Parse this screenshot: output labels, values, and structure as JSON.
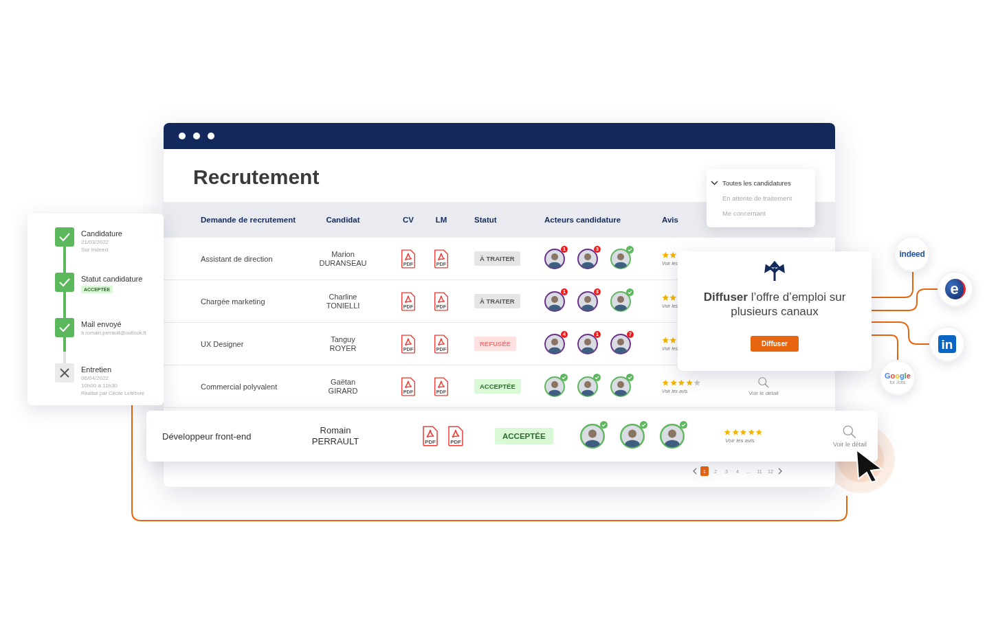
{
  "window": {
    "title": "Recrutement"
  },
  "filter_menu": {
    "items": [
      {
        "label": "Toutes les candidatures",
        "selected": true
      },
      {
        "label": "En attente de traitement",
        "selected": false
      },
      {
        "label": "Me concernant",
        "selected": false
      }
    ]
  },
  "table": {
    "columns": [
      "Demande de recrutement",
      "Candidat",
      "CV",
      "LM",
      "Statut",
      "Acteurs candidature",
      "Avis"
    ],
    "rows": [
      {
        "position": "Assistant de direction",
        "first_name": "Marion",
        "last_name": "DURANSEAU",
        "cv": "PDF",
        "lm": "PDF",
        "status": {
          "kind": "todo",
          "label": "À TRAITER"
        },
        "actors": [
          {
            "kind": "count",
            "badge": "1"
          },
          {
            "kind": "count",
            "badge": "3"
          },
          {
            "kind": "done"
          }
        ],
        "reviews": "Voir les"
      },
      {
        "position": "Chargée marketing",
        "first_name": "Charline",
        "last_name": "TONIELLI",
        "cv": "PDF",
        "lm": "PDF",
        "status": {
          "kind": "todo",
          "label": "À TRAITER"
        },
        "actors": [
          {
            "kind": "count",
            "badge": "1"
          },
          {
            "kind": "count",
            "badge": "3"
          },
          {
            "kind": "done"
          }
        ],
        "reviews": "Voir les"
      },
      {
        "position": "UX Designer",
        "first_name": "Tanguy",
        "last_name": "ROYER",
        "cv": "PDF",
        "lm": "PDF",
        "status": {
          "kind": "refused",
          "label": "REFUSÉE"
        },
        "actors": [
          {
            "kind": "count",
            "badge": "4"
          },
          {
            "kind": "count",
            "badge": "1"
          },
          {
            "kind": "count",
            "badge": "7"
          }
        ],
        "reviews": "Voir les"
      },
      {
        "position": "Commercial polyvalent",
        "first_name": "Gaëtan",
        "last_name": "GIRARD",
        "cv": "PDF",
        "lm": "PDF",
        "status": {
          "kind": "accepted",
          "label": "ACCEPTÉE"
        },
        "actors": [
          {
            "kind": "done"
          },
          {
            "kind": "done"
          },
          {
            "kind": "done"
          }
        ],
        "stars": 4,
        "reviews": "Voir les avis",
        "detail": "Voir le détail"
      }
    ]
  },
  "expanded_row": {
    "position": "Développeur front-end",
    "first_name": "Romain",
    "last_name": "PERRAULT",
    "cv": "PDF",
    "lm": "PDF",
    "status": {
      "kind": "accepted",
      "label": "ACCEPTÉE"
    },
    "actors": [
      {
        "kind": "done"
      },
      {
        "kind": "done"
      },
      {
        "kind": "done"
      }
    ],
    "stars": 5,
    "reviews": "Voir les avis",
    "detail": "Voir le détail"
  },
  "pagination": {
    "pages": [
      {
        "label": "1",
        "selected": true
      },
      {
        "label": "2",
        "selected": false
      },
      {
        "label": "3",
        "selected": false
      },
      {
        "label": "4",
        "selected": false
      },
      {
        "label": "...",
        "selected": false
      },
      {
        "label": "11",
        "selected": false
      },
      {
        "label": "12",
        "selected": false
      }
    ]
  },
  "timeline": {
    "steps": [
      {
        "kind": "done",
        "title": "Candidature",
        "lines": [
          "21/03/2022",
          "Sur Indeed"
        ]
      },
      {
        "kind": "done",
        "title": "Statut candidature",
        "badge": "ACCEPTÉE"
      },
      {
        "kind": "done",
        "title": "Mail envoyé",
        "lines": [
          "à romain.perrault@outlook.fr"
        ]
      },
      {
        "kind": "pending",
        "title": "Entretien",
        "lines": [
          "06/04/2022",
          "10h00 à 11h30",
          "Réalisé par Cécile Lefèbvre"
        ]
      }
    ]
  },
  "publish_popup": {
    "text": "**Diffuser** l’offre d’emploi sur plusieurs canaux",
    "button": "Diffuser"
  },
  "channels": [
    {
      "kind": "indeed",
      "label": "indeed"
    },
    {
      "kind": "pole-emploi",
      "label": "e"
    },
    {
      "kind": "linkedin",
      "label": "in"
    },
    {
      "kind": "google",
      "label": "Google",
      "sub": "for Jobs"
    }
  ]
}
